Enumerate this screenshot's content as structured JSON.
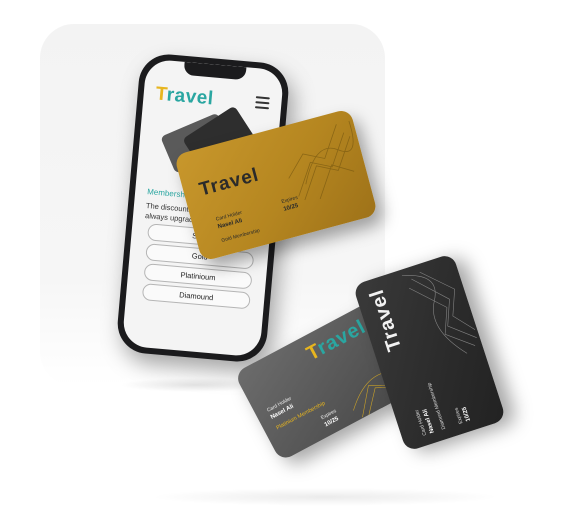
{
  "phone_app": {
    "logo_initial": "T",
    "logo_rest": "ravel",
    "membership_title": "Membership Program",
    "membership_desc_line1": "The discount more all",
    "membership_desc_line2": "always upgrade binifit f",
    "tiers": [
      "Silver",
      "Gold",
      "Platinioum",
      "Diamound"
    ]
  },
  "gold_card": {
    "brand": "Travel",
    "holder_label": "Card Holder",
    "holder_name": "Nasel Ali",
    "expires_label": "Expires",
    "expires_value": "10/25",
    "tier": "Gold Membership",
    "color": "#b58620"
  },
  "platinum_card": {
    "brand_initial": "T",
    "brand_rest": "ravel",
    "holder_label": "Card Holder",
    "holder_name": "Nasel Ali",
    "expires_label": "Expires",
    "expires_value": "10/25",
    "tier": "Platinium Membership",
    "color": "#565656"
  },
  "diamond_card": {
    "brand": "Travel",
    "holder_label": "Card Holder",
    "holder_name": "Nasel Ali",
    "expires_label": "Expires",
    "expires_value": "10/25",
    "tier": "Diamond Membership",
    "color": "#2b2b2b"
  },
  "colors": {
    "accent_teal": "#2aa6a1",
    "accent_yellow": "#e7b51f"
  }
}
